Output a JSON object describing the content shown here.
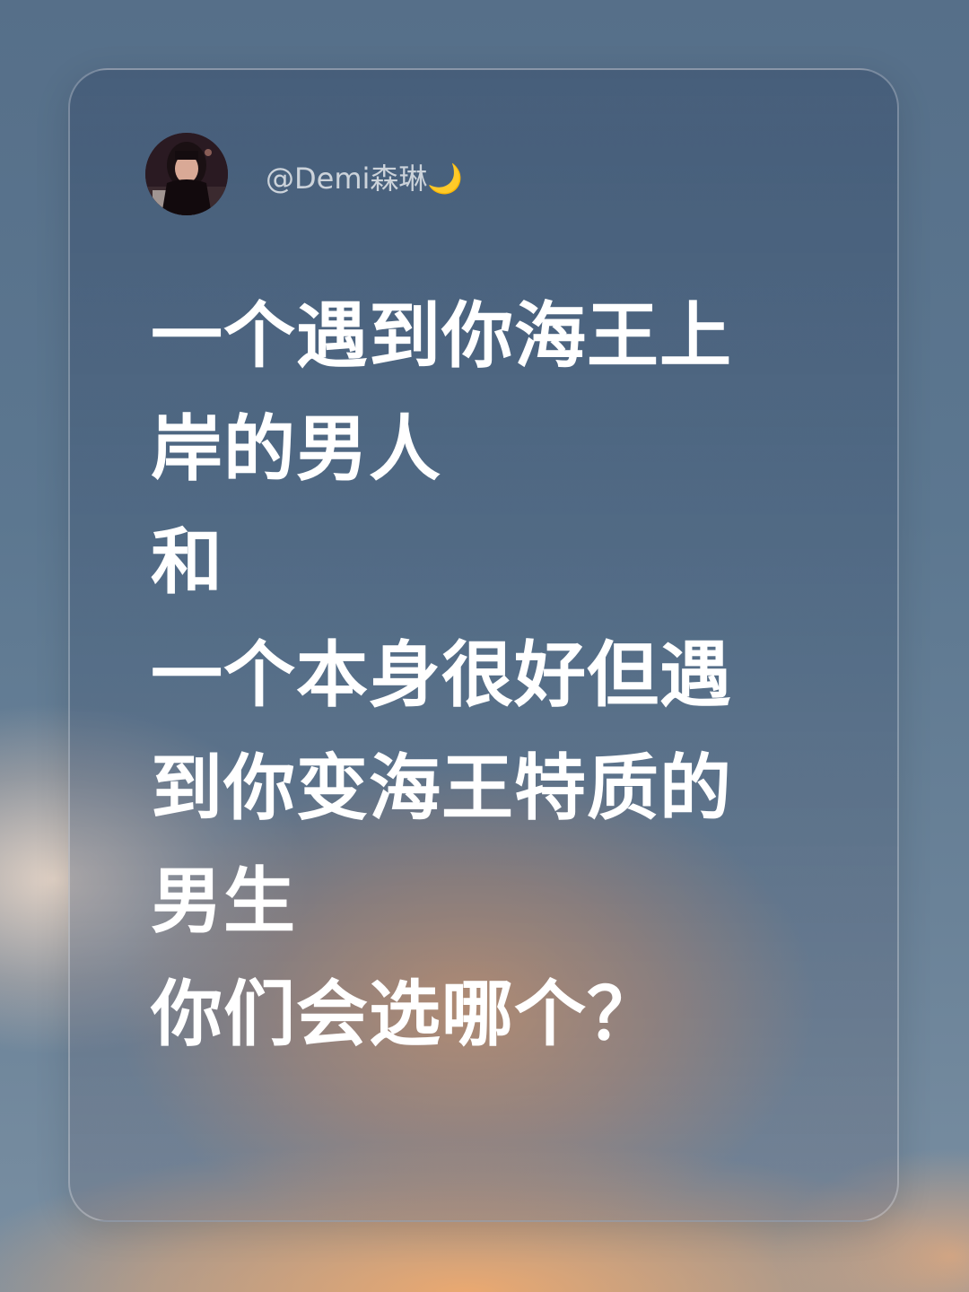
{
  "author": {
    "handle": "@Demi森琳",
    "handle_emoji": "🌙",
    "avatar_icon": "profile-photo"
  },
  "post": {
    "lines": [
      "一个遇到你海王上",
      "岸的男人",
      "和",
      "一个本身很好但遇",
      "到你变海王特质的",
      "男生",
      "你们会选哪个？"
    ]
  },
  "colors": {
    "text": "#ffffff",
    "card_border": "rgba(255,255,255,0.28)",
    "sky": "#5f7890",
    "cloud_glow": "#e2a06e"
  }
}
